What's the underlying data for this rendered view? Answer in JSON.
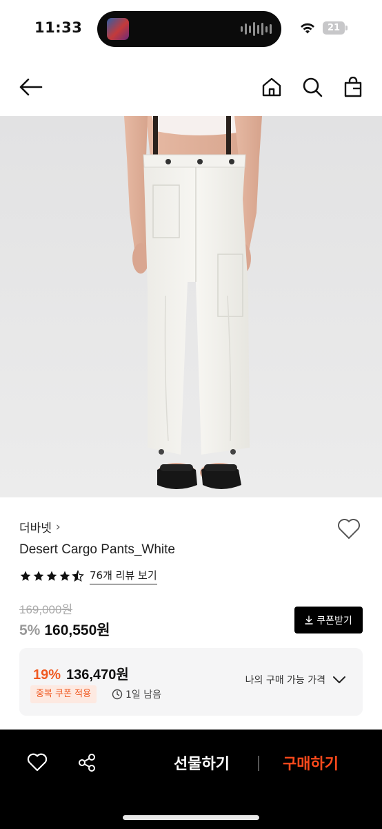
{
  "status_bar": {
    "time": "11:33",
    "battery": "21"
  },
  "product": {
    "brand": "더바넷",
    "title": "Desert Cargo Pants_White",
    "rating": 4.5,
    "review_link": "76개 리뷰 보기",
    "original_price": "169,000원",
    "discount_rate": "5%",
    "sale_price": "160,550원",
    "coupon_button": "쿠폰받기"
  },
  "best_price": {
    "rate": "19%",
    "price": "136,470원",
    "coupon_badge": "중복 쿠폰 적용",
    "time_left": "1일 남음",
    "my_price_label": "나의 구매 가능 가격"
  },
  "bottom_bar": {
    "gift_label": "선물하기",
    "buy_label": "구매하기"
  },
  "colors": {
    "accent_orange": "#f05a22",
    "buy_orange": "#ff4a1c",
    "bottom_bar": "#000000"
  },
  "icons": [
    "back-arrow-icon",
    "home-icon",
    "search-icon",
    "shopping-bag-icon",
    "heart-icon",
    "star-icon",
    "download-icon",
    "clock-icon",
    "chevron-down-icon",
    "share-icon"
  ]
}
